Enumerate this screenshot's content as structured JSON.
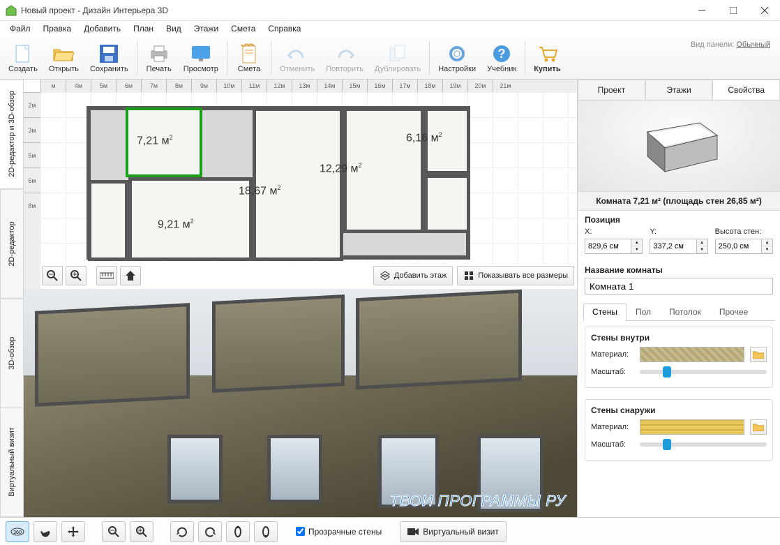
{
  "window_title": "Новый проект - Дизайн Интерьера 3D",
  "menu": [
    "Файл",
    "Правка",
    "Добавить",
    "План",
    "Вид",
    "Этажи",
    "Смета",
    "Справка"
  ],
  "toolbar": {
    "create": "Создать",
    "open": "Открыть",
    "save": "Сохранить",
    "print": "Печать",
    "preview": "Просмотр",
    "estimate": "Смета",
    "undo": "Отменить",
    "redo": "Повторить",
    "duplicate": "Дублировать",
    "settings": "Настройки",
    "tutorial": "Учебник",
    "buy": "Купить",
    "panelview_label": "Вид панели:",
    "panelview_value": "Обычный"
  },
  "left_tabs": [
    "2D-редактор и 3D-обзор",
    "2D-редактор",
    "3D-обзор",
    "Виртуальный визит"
  ],
  "ruler_h": [
    "м",
    "4м",
    "5м",
    "6м",
    "7м",
    "8м",
    "9м",
    "10м",
    "11м",
    "12м",
    "13м",
    "14м",
    "15м",
    "16м",
    "17м",
    "18м",
    "19м",
    "20м",
    "21м"
  ],
  "ruler_v": [
    "2м",
    "3м",
    "5м",
    "6м",
    "8м"
  ],
  "rooms": {
    "r1": "7,21 м",
    "r2": "18,67 м",
    "r3": "12,29 м",
    "r4": "6,16 м",
    "r5": "9,21 м"
  },
  "plan_buttons": {
    "add_floor": "Добавить этаж",
    "show_sizes": "Показывать все размеры"
  },
  "right_tabs": [
    "Проект",
    "Этажи",
    "Свойства"
  ],
  "room_title": "Комната 7,21 м²  (площадь стен 26,85 м²)",
  "position": {
    "header": "Позиция",
    "x_label": "X:",
    "y_label": "Y:",
    "h_label": "Высота стен:",
    "x": "829,6 см",
    "y": "337,2 см",
    "h": "250,0 см"
  },
  "roomname": {
    "label": "Название комнаты",
    "value": "Комната 1"
  },
  "subtabs": [
    "Стены",
    "Пол",
    "Потолок",
    "Прочее"
  ],
  "walls_in": {
    "title": "Стены внутри",
    "mat_label": "Материал:",
    "scale_label": "Масштаб:"
  },
  "walls_out": {
    "title": "Стены снаружи",
    "mat_label": "Материал:",
    "scale_label": "Масштаб:"
  },
  "bottom": {
    "trans_walls": "Прозрачные стены",
    "vvisit": "Виртуальный визит"
  },
  "watermark": "ТВОИ ПРОГРАММЫ РУ"
}
